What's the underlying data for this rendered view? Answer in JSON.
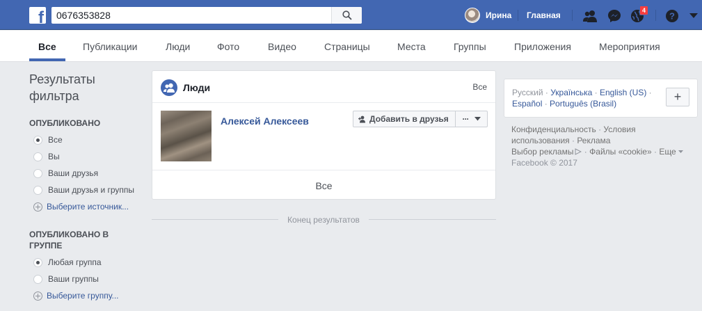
{
  "topbar": {
    "logo": "f",
    "search_value": "0676353828",
    "search_icon": "search-icon",
    "user_name": "Ирина",
    "home_label": "Главная",
    "notification_count": "4",
    "brand_color": "#4267b2"
  },
  "tabs": [
    {
      "label": "Все",
      "active": true
    },
    {
      "label": "Публикации"
    },
    {
      "label": "Люди"
    },
    {
      "label": "Фото"
    },
    {
      "label": "Видео"
    },
    {
      "label": "Страницы"
    },
    {
      "label": "Места"
    },
    {
      "label": "Группы"
    },
    {
      "label": "Приложения"
    },
    {
      "label": "Мероприятия"
    }
  ],
  "filters": {
    "title": "Результаты фильтра",
    "published": {
      "heading": "ОПУБЛИКОВАНО",
      "options": [
        "Все",
        "Вы",
        "Ваши друзья",
        "Ваши друзья и группы"
      ],
      "selected": "Все",
      "more": "Выберите источник..."
    },
    "group": {
      "heading": "ОПУБЛИКОВАНО В ГРУППЕ",
      "options": [
        "Любая группа",
        "Ваши группы"
      ],
      "selected": "Любая группа",
      "more": "Выберите группу..."
    }
  },
  "results": {
    "section_title": "Люди",
    "see_all_top": "Все",
    "person_name": "Алексей Алексеев",
    "add_friend_label": "Добавить в друзья",
    "more_label": "···",
    "see_all_bottom": "Все",
    "end_text": "Конец результатов"
  },
  "languages": {
    "current": "Русский",
    "others": [
      "Українська",
      "English (US)",
      "Español",
      "Português (Brasil)"
    ],
    "add_label": "+"
  },
  "footer": {
    "privacy": "Конфиденциальность",
    "terms": "Условия использования",
    "ads": "Реклама",
    "ad_choices": "Выбор рекламы",
    "cookies": "Файлы «cookie»",
    "more": "Еще",
    "copyright": "Facebook © 2017"
  }
}
